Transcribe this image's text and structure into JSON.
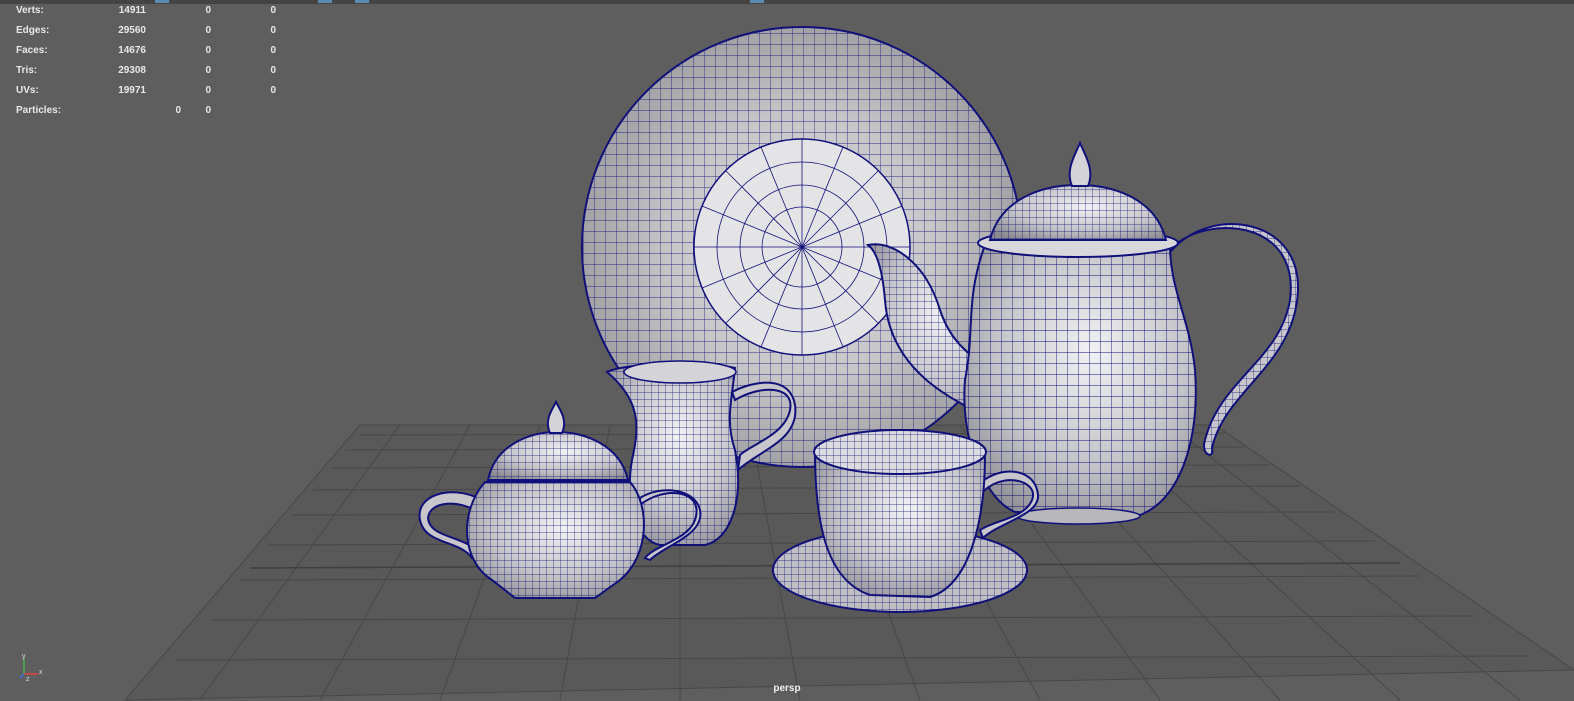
{
  "hud": {
    "rows": [
      {
        "label": "Verts:",
        "values": [
          "14911",
          "0",
          "0"
        ]
      },
      {
        "label": "Edges:",
        "values": [
          "29560",
          "0",
          "0"
        ]
      },
      {
        "label": "Faces:",
        "values": [
          "14676",
          "0",
          "0"
        ]
      },
      {
        "label": "Tris:",
        "values": [
          "29308",
          "0",
          "0"
        ]
      },
      {
        "label": "UVs:",
        "values": [
          "19971",
          "0",
          "0"
        ]
      }
    ],
    "particles": {
      "label": "Particles:",
      "values": [
        "0",
        "0"
      ]
    }
  },
  "viewport": {
    "camera_label": "persp",
    "axis": {
      "y": "y",
      "x": "x",
      "z": "z"
    }
  },
  "scene": {
    "objects": [
      "plate",
      "teapot",
      "creamer",
      "sugar-bowl",
      "teacup",
      "saucer",
      "ground-grid"
    ],
    "wire_color": "#10107a",
    "surface_color": "#c8c8cc",
    "grid_color": "#4a4a4a"
  }
}
